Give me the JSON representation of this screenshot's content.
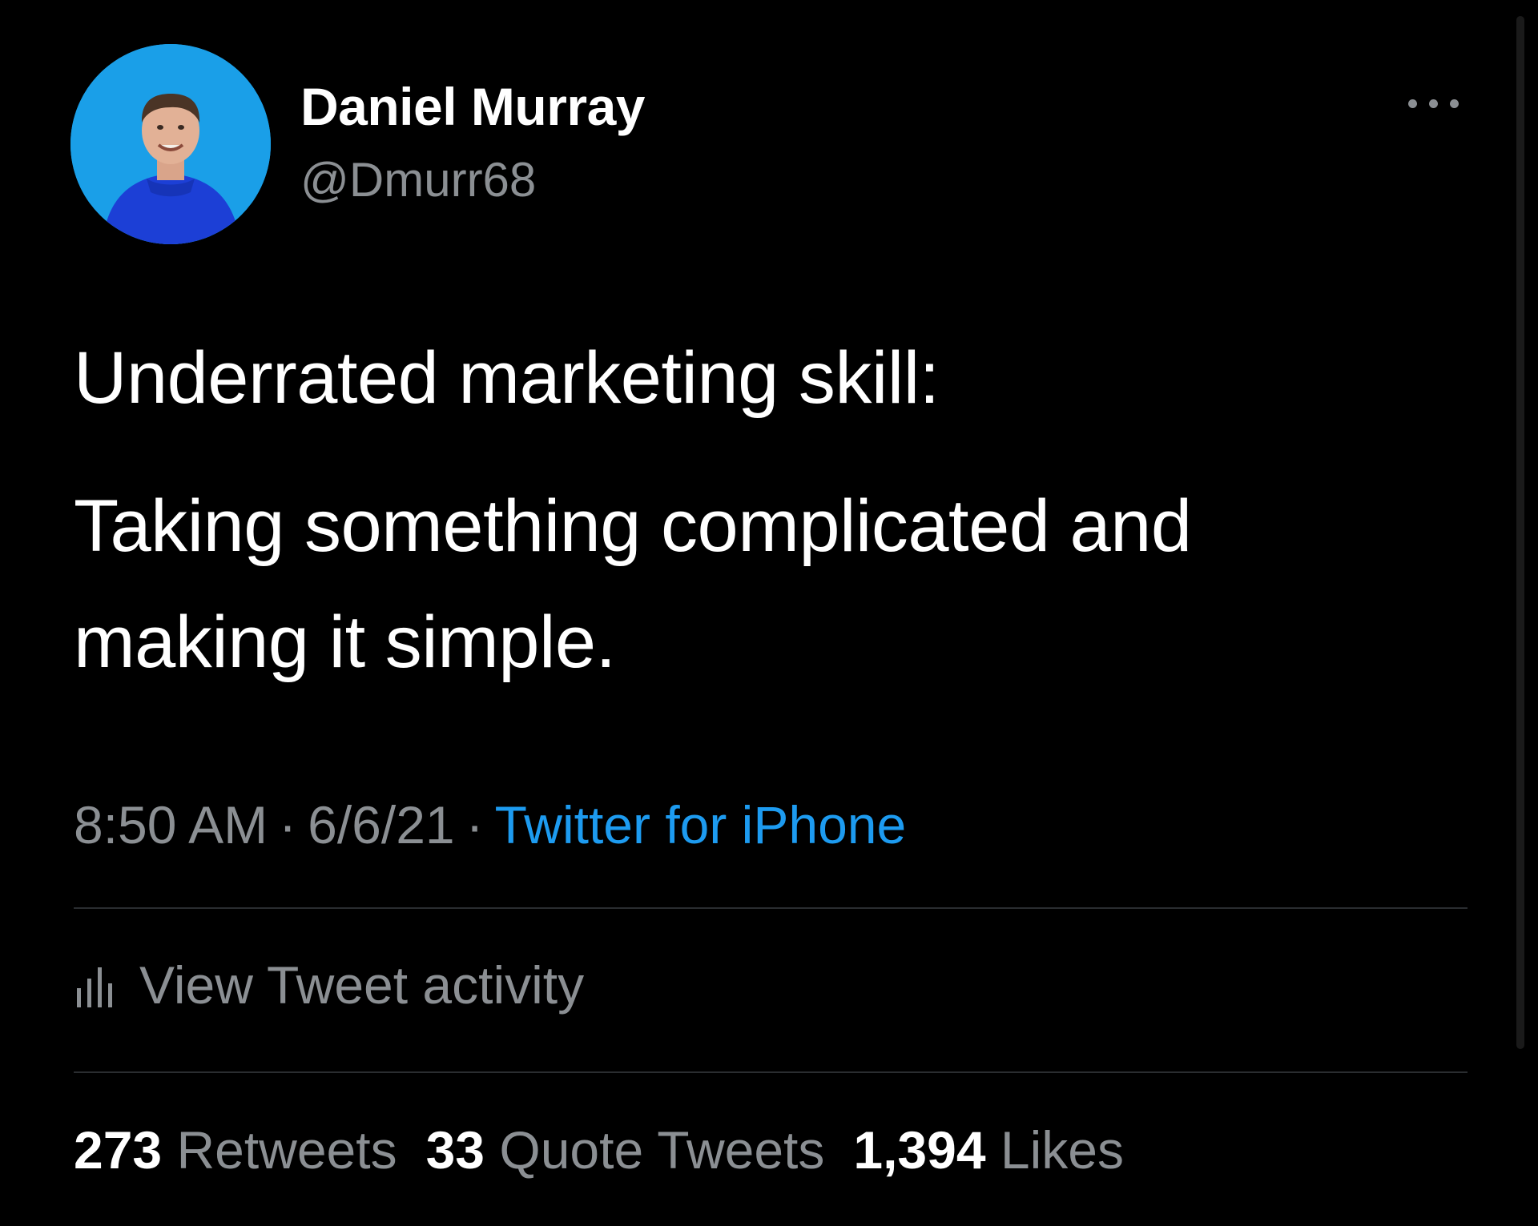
{
  "user": {
    "name": "Daniel Murray",
    "handle": "@Dmurr68",
    "avatar_bg": "#1a9fe8"
  },
  "tweet": {
    "lines": [
      "Underrated marketing skill:",
      "Taking something complicated and",
      "making it simple."
    ]
  },
  "meta": {
    "time": "8:50 AM",
    "separator": "·",
    "date": "6/6/21",
    "source": "Twitter for iPhone"
  },
  "activity": {
    "icon": "bar-chart-icon",
    "label": "View Tweet activity"
  },
  "stats": {
    "retweets_count": "273",
    "retweets_label": "Retweets",
    "quotes_count": "33",
    "quotes_label": "Quote Tweets",
    "likes_count": "1,394",
    "likes_label": "Likes"
  },
  "colors": {
    "background": "#000000",
    "text_primary": "#ffffff",
    "text_secondary": "#8b8f93",
    "link": "#1d9bf0",
    "divider": "#2a2d30"
  },
  "icons": {
    "more": "more-horizontal-icon"
  }
}
